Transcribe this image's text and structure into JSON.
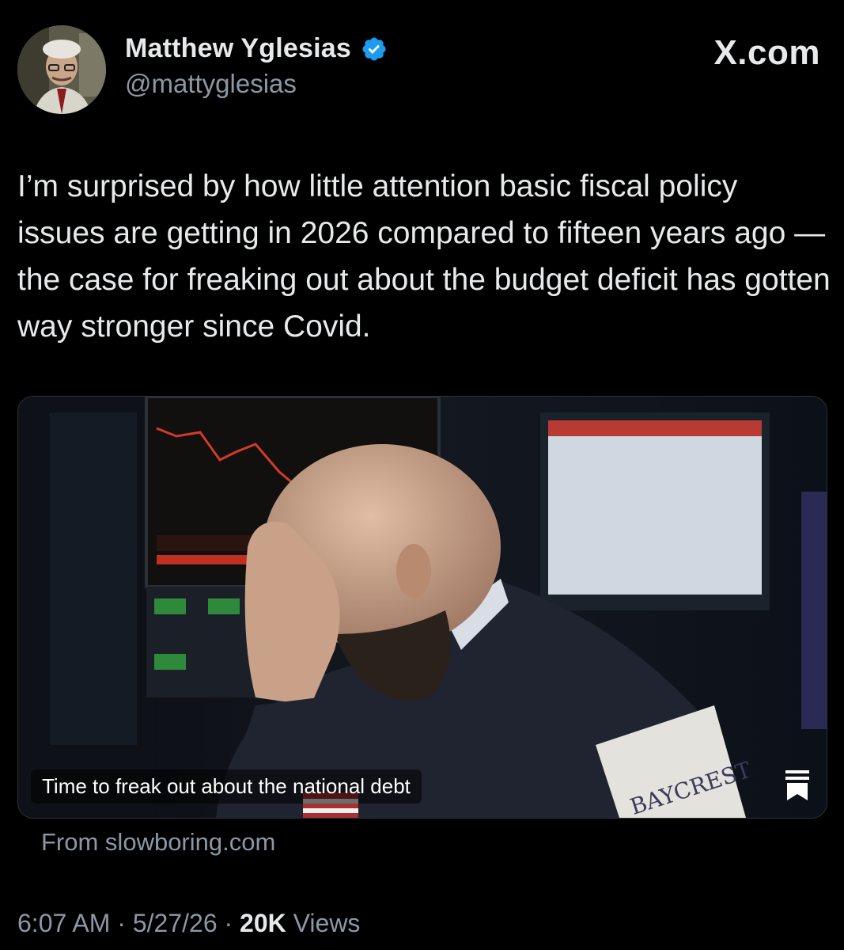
{
  "author": {
    "display_name": "Matthew Yglesias",
    "handle": "@mattyglesias",
    "verified": true
  },
  "brand": {
    "label": "X.com"
  },
  "tweet": {
    "text": "I’m surprised by how little attention basic fiscal policy issues are getting in 2026 compared to fifteen years ago — the case for freaking out about the budget deficit has gotten way stronger since Covid."
  },
  "card": {
    "title": "Time to freak out about the national debt",
    "source": "From slowboring.com",
    "jacket_logo": "BAYCREST"
  },
  "meta": {
    "time": "6:07 AM",
    "separator": "·",
    "date": "5/27/26",
    "views_count": "20K",
    "views_label": "Views"
  },
  "colors": {
    "background": "#000000",
    "text_primary": "#e7e9ea",
    "text_secondary": "#8b98a5",
    "verified_blue": "#1d9bf0"
  },
  "icons": [
    "verified-badge-icon",
    "bookmark-icon"
  ]
}
